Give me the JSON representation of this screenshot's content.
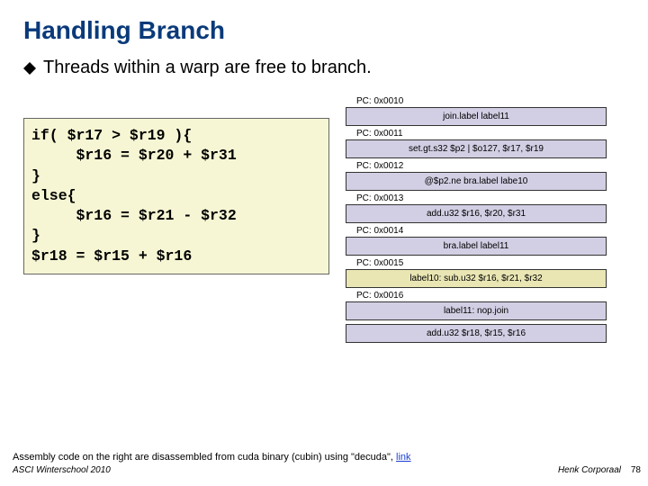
{
  "title": "Handling Branch",
  "bullet": "Threads within a warp are free to branch.",
  "code": "if( $r17 > $r19 ){\n     $r16 = $r20 + $r31\n}\nelse{\n     $r16 = $r21 - $r32\n}\n$r18 = $r15 + $r16",
  "asm": [
    {
      "pc": "PC: 0x0010",
      "text": "join.label label11",
      "cls": ""
    },
    {
      "pc": "PC: 0x0011",
      "text": "set.gt.s32 $p2 | $o127, $r17, $r19",
      "cls": ""
    },
    {
      "pc": "PC: 0x0012",
      "text": "@$p2.ne bra.label labe10",
      "cls": ""
    },
    {
      "pc": "PC: 0x0013",
      "text": "add.u32 $r16, $r20, $r31",
      "cls": ""
    },
    {
      "pc": "PC: 0x0014",
      "text": "bra.label label11",
      "cls": ""
    },
    {
      "pc": "PC: 0x0015",
      "text": "label10: sub.u32 $r16, $r21, $r32",
      "cls": "yellow"
    },
    {
      "pc": "PC: 0x0016",
      "text": "label11: nop.join",
      "cls": ""
    },
    {
      "pc": "",
      "text": "add.u32 $r18, $r15, $r16",
      "cls": ""
    }
  ],
  "footnote_prefix": "Assembly code on the right are disassembled from cuda binary (cubin) using \"decuda\", ",
  "footnote_link": "link",
  "footer_left": "ASCI Winterschool 2010",
  "footer_right": "Henk Corporaal",
  "pagenum": "78"
}
